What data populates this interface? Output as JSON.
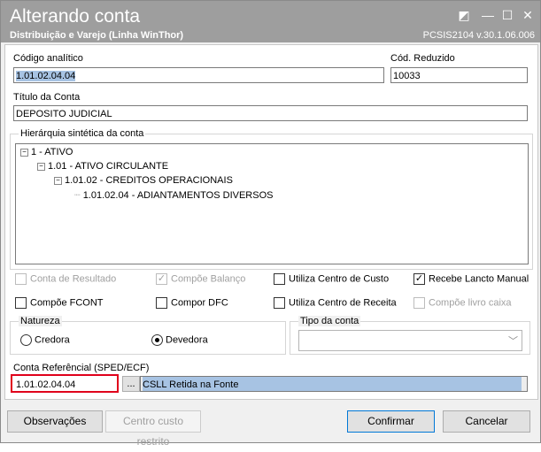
{
  "window": {
    "title": "Alterando conta",
    "subtitle": "Distribuição e Varejo (Linha WinThor)",
    "version": "PCSIS2104  v.30.1.06.006"
  },
  "fields": {
    "codigo_analitico_label": "Código analítico",
    "codigo_analitico_value": "1.01.02.04.04",
    "cod_reduzido_label": "Cód. Reduzido",
    "cod_reduzido_value": "10033",
    "titulo_label": "Título da Conta",
    "titulo_value": "DEPOSITO JUDICIAL"
  },
  "hierarchy": {
    "label": "Hierárquia sintética da conta",
    "nodes": [
      {
        "text": "1 - ATIVO",
        "toggle": "−"
      },
      {
        "text": "1.01 - ATIVO CIRCULANTE",
        "toggle": "−"
      },
      {
        "text": "1.01.02 - CREDITOS OPERACIONAIS",
        "toggle": "−"
      },
      {
        "text": "1.01.02.04 - ADIANTAMENTOS DIVERSOS",
        "toggle": ""
      }
    ]
  },
  "options": {
    "conta_resultado": {
      "label": "Conta de Resultado",
      "checked": false,
      "enabled": false
    },
    "compoe_balanco": {
      "label": "Compõe Balanço",
      "checked": true,
      "enabled": false
    },
    "centro_custo": {
      "label": "Utiliza Centro de Custo",
      "checked": false,
      "enabled": true
    },
    "recebe_lancto": {
      "label": "Recebe Lancto Manual",
      "checked": true,
      "enabled": true
    },
    "compoe_fcont": {
      "label": "Compõe FCONT",
      "checked": false,
      "enabled": true
    },
    "compor_dfc": {
      "label": "Compor DFC",
      "checked": false,
      "enabled": true
    },
    "centro_receita": {
      "label": "Utiliza Centro de Receita",
      "checked": false,
      "enabled": true
    },
    "livro_caixa": {
      "label": "Compõe livro caixa",
      "checked": false,
      "enabled": false
    }
  },
  "natureza": {
    "label": "Natureza",
    "credora": "Credora",
    "devedora": "Devedora",
    "selected": "Devedora"
  },
  "tipo_conta": {
    "label": "Tipo da conta",
    "value": ""
  },
  "referencial": {
    "label": "Conta Referêncial (SPED/ECF)",
    "code": "1.01.02.04.04",
    "ellipsis": "...",
    "description": "CSLL Retida na Fonte"
  },
  "buttons": {
    "observacoes": "Observações",
    "centro_custo_restrito": "Centro custo restrito",
    "confirmar": "Confirmar",
    "cancelar": "Cancelar"
  },
  "colors": {
    "titlebar": "#9e9e9e",
    "selection": "#a7c3e3",
    "highlight_border": "#e0001b"
  }
}
